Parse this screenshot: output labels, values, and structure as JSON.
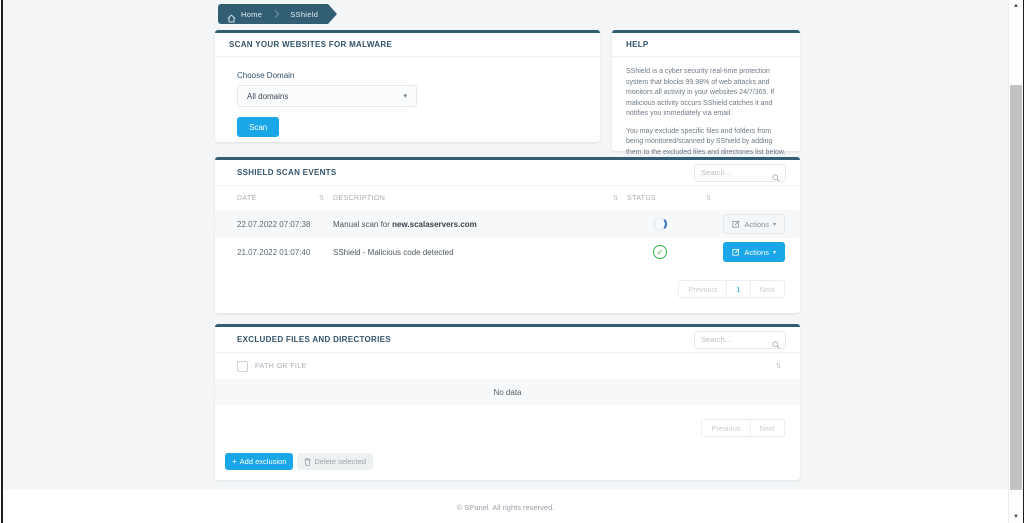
{
  "breadcrumb": {
    "home_label": "Home",
    "current_label": "SShield"
  },
  "scan_card": {
    "title": "SCAN YOUR WEBSITES FOR MALWARE",
    "choose_domain_label": "Choose Domain",
    "domain_selected": "All domains",
    "scan_button_label": "Scan"
  },
  "help_card": {
    "title": "HELP",
    "paragraph1": "SShield is a cyber security real-time protection system that blocks 99.98% of web attacks and monitors all activity in your websites 24/7/365. If malicious activity occurs SShield catches it and notifies you immediately via email.",
    "paragraph2": "You may exclude specific files and folders from being monitored/scanned by SShield by adding them to the excluded files and directories list below."
  },
  "events_card": {
    "title": "SSHIELD SCAN EVENTS",
    "search_placeholder": "Search...",
    "columns": {
      "date": "DATE",
      "description": "DESCRIPTION",
      "status": "STATUS"
    },
    "rows": [
      {
        "date": "22.07.2022 07:07:38",
        "description": "Manual scan for ",
        "description_bold": "new.scalaservers.com",
        "status": "in-progress",
        "actions_label": "Actions"
      },
      {
        "date": "21.07.2022 01:07:40",
        "description": "SShield - Malicious code detected",
        "description_bold": "",
        "status": "success",
        "actions_label": "Actions"
      }
    ],
    "pagination": {
      "previous_label": "Previous",
      "page_label": "1",
      "next_label": "Next"
    }
  },
  "excluded_card": {
    "title": "EXCLUDED FILES AND DIRECTORIES",
    "search_placeholder": "Search...",
    "columns": {
      "path": "PATH OR FILE"
    },
    "empty_text": "No data",
    "pagination": {
      "previous_label": "Previous",
      "next_label": "Next"
    },
    "add_exclusion_label": "Add exclusion",
    "delete_selected_label": "Delete selected"
  },
  "footer": {
    "copyright": "© SPanel. All rights reserved."
  },
  "icons": {
    "sort_glyph": "⇅",
    "caret_glyph": "▾",
    "check_glyph": "✓",
    "plus_glyph": "+",
    "scroll_up_glyph": "▲",
    "scroll_down_glyph": "▼"
  },
  "colors": {
    "accent_blue": "#1aa7e8",
    "brand_teal": "#315e74",
    "success_green": "#35b14b",
    "spinner_blue": "#3b6fd8",
    "page_background": "#f3f5f6"
  }
}
